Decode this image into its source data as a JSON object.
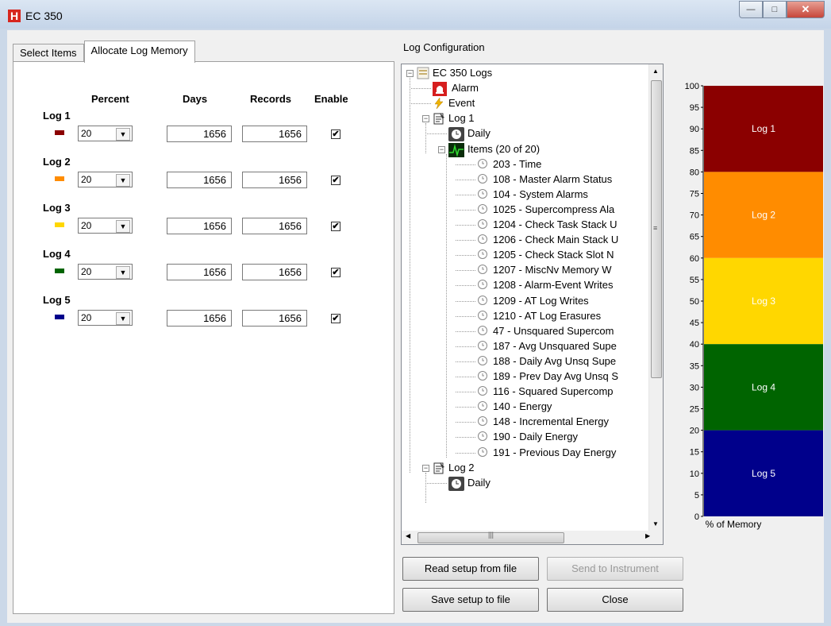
{
  "window": {
    "title": "EC 350",
    "app_icon_letter": "H"
  },
  "tabs": [
    {
      "label": "Select Items"
    },
    {
      "label": "Allocate Log Memory"
    }
  ],
  "allocate": {
    "headers": {
      "percent": "Percent",
      "days": "Days",
      "records": "Records",
      "enable": "Enable"
    },
    "logs": [
      {
        "label": "Log 1",
        "color": "#8b0000",
        "percent": "20",
        "days": "1656",
        "records": "1656",
        "enabled": true
      },
      {
        "label": "Log 2",
        "color": "#ff8c00",
        "percent": "20",
        "days": "1656",
        "records": "1656",
        "enabled": true
      },
      {
        "label": "Log 3",
        "color": "#ffd700",
        "percent": "20",
        "days": "1656",
        "records": "1656",
        "enabled": true
      },
      {
        "label": "Log 4",
        "color": "#006400",
        "percent": "20",
        "days": "1656",
        "records": "1656",
        "enabled": true
      },
      {
        "label": "Log 5",
        "color": "#00008b",
        "percent": "20",
        "days": "1656",
        "records": "1656",
        "enabled": true
      }
    ]
  },
  "log_config": {
    "label": "Log Configuration",
    "tree": {
      "root": "EC 350 Logs",
      "alarm": "Alarm",
      "event": "Event",
      "log1": "Log 1",
      "daily": "Daily",
      "items": "Items (20 of 20)",
      "item_list": [
        "203 - Time",
        "108 - Master Alarm Status",
        "104 - System Alarms",
        "1025 - Supercompress Ala",
        "1204 - Check Task Stack U",
        "1206 - Check Main Stack U",
        "1205 - Check Stack Slot N",
        "1207 - MiscNv Memory W",
        "1208 - Alarm-Event Writes",
        "1209 - AT Log Writes",
        "1210 - AT Log Erasures",
        "47 - Unsquared Supercom",
        "187 - Avg Unsquared Supe",
        "188 - Daily Avg Unsq Supe",
        "189 - Prev Day Avg Unsq S",
        "116 - Squared Supercomp",
        "140 - Energy",
        "148 - Incremental Energy",
        "190 - Daily Energy",
        "191 - Previous Day Energy"
      ],
      "log2": "Log 2",
      "daily2": "Daily"
    }
  },
  "buttons": {
    "read_setup": "Read setup from file",
    "send_instrument": "Send to Instrument",
    "save_setup": "Save setup to file",
    "close": "Close"
  },
  "chart_data": {
    "type": "bar",
    "stacked": true,
    "ylim": [
      0,
      100
    ],
    "yticks": [
      "100",
      "95",
      "90",
      "85",
      "80",
      "75",
      "70",
      "65",
      "60",
      "55",
      "50",
      "45",
      "40",
      "35",
      "30",
      "25",
      "20",
      "15",
      "10",
      "5",
      "0"
    ],
    "xlabel": "% of Memory",
    "series": [
      {
        "name": "Log 1",
        "value": 20,
        "color": "#8b0000"
      },
      {
        "name": "Log 2",
        "value": 20,
        "color": "#ff8c00"
      },
      {
        "name": "Log 3",
        "value": 20,
        "color": "#ffd700"
      },
      {
        "name": "Log 4",
        "value": 20,
        "color": "#006400"
      },
      {
        "name": "Log 5",
        "value": 20,
        "color": "#00008b"
      }
    ]
  }
}
